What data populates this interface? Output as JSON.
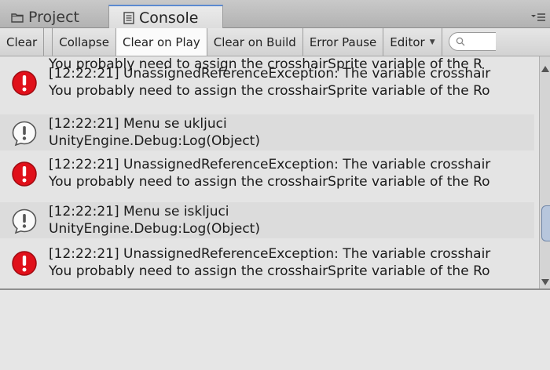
{
  "tabs": {
    "project_label": "Project",
    "console_label": "Console"
  },
  "toolbar": {
    "clear": "Clear",
    "collapse": "Collapse",
    "clear_on_play": "Clear on Play",
    "clear_on_build": "Clear on Build",
    "error_pause": "Error Pause",
    "editor": "Editor"
  },
  "log": {
    "partial_top": "You probably need to assign the crosshairSprite variable of the R",
    "entries": [
      {
        "type": "error",
        "line1": "[12:22:21] UnassignedReferenceException: The variable crosshair",
        "line2": "You probably need to assign the crosshairSprite variable of the Ro"
      },
      {
        "type": "log",
        "line1": "[12:22:21] Menu se ukljuci",
        "line2": "UnityEngine.Debug:Log(Object)"
      },
      {
        "type": "error",
        "line1": "[12:22:21] UnassignedReferenceException: The variable crosshair",
        "line2": "You probably need to assign the crosshairSprite variable of the Ro"
      },
      {
        "type": "log",
        "line1": "[12:22:21] Menu se iskljuci",
        "line2": "UnityEngine.Debug:Log(Object)"
      },
      {
        "type": "error",
        "line1": "[12:22:21] UnassignedReferenceException: The variable crosshair",
        "line2": "You probably need to assign the crosshairSprite variable of the Ro"
      }
    ]
  },
  "icons": {
    "error": "error-icon",
    "log": "info-icon",
    "search": "search-icon",
    "menu": "panel-menu-icon"
  },
  "colors": {
    "error_red": "#e0101a",
    "tab_accent": "#5c8ad0"
  }
}
